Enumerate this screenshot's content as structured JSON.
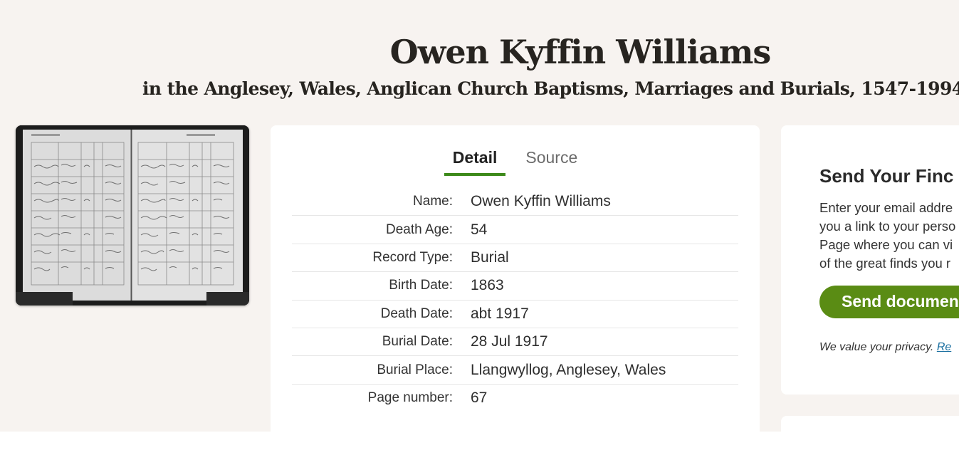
{
  "header": {
    "title": "Owen Kyffin Williams",
    "subtitle": "in the Anglesey, Wales, Anglican Church Baptisms, Marriages and Burials, 1547-1994"
  },
  "tabs": [
    {
      "label": "Detail",
      "active": true
    },
    {
      "label": "Source",
      "active": false
    }
  ],
  "record": [
    {
      "label": "Name:",
      "value": "Owen Kyffin Williams"
    },
    {
      "label": "Death Age:",
      "value": "54"
    },
    {
      "label": "Record Type:",
      "value": "Burial"
    },
    {
      "label": "Birth Date:",
      "value": "1863"
    },
    {
      "label": "Death Date:",
      "value": "abt 1917"
    },
    {
      "label": "Burial Date:",
      "value": "28 Jul 1917"
    },
    {
      "label": "Burial Place:",
      "value": "Llangwyllog, Anglesey, Wales"
    },
    {
      "label": "Page number:",
      "value": "67"
    }
  ],
  "send_card": {
    "title": "Send Your Finc",
    "body_lines": [
      "Enter your email addre",
      "you a link to your perso",
      "Page where you can vi",
      "of the great finds you r"
    ],
    "button_label": "Send documen",
    "privacy_text": "We value your privacy. ",
    "privacy_link": "Re"
  },
  "colors": {
    "background": "#f7f3f0",
    "accent_green": "#3d8a1a",
    "button_green": "#5a8c14",
    "link_blue": "#1a6fa0"
  }
}
